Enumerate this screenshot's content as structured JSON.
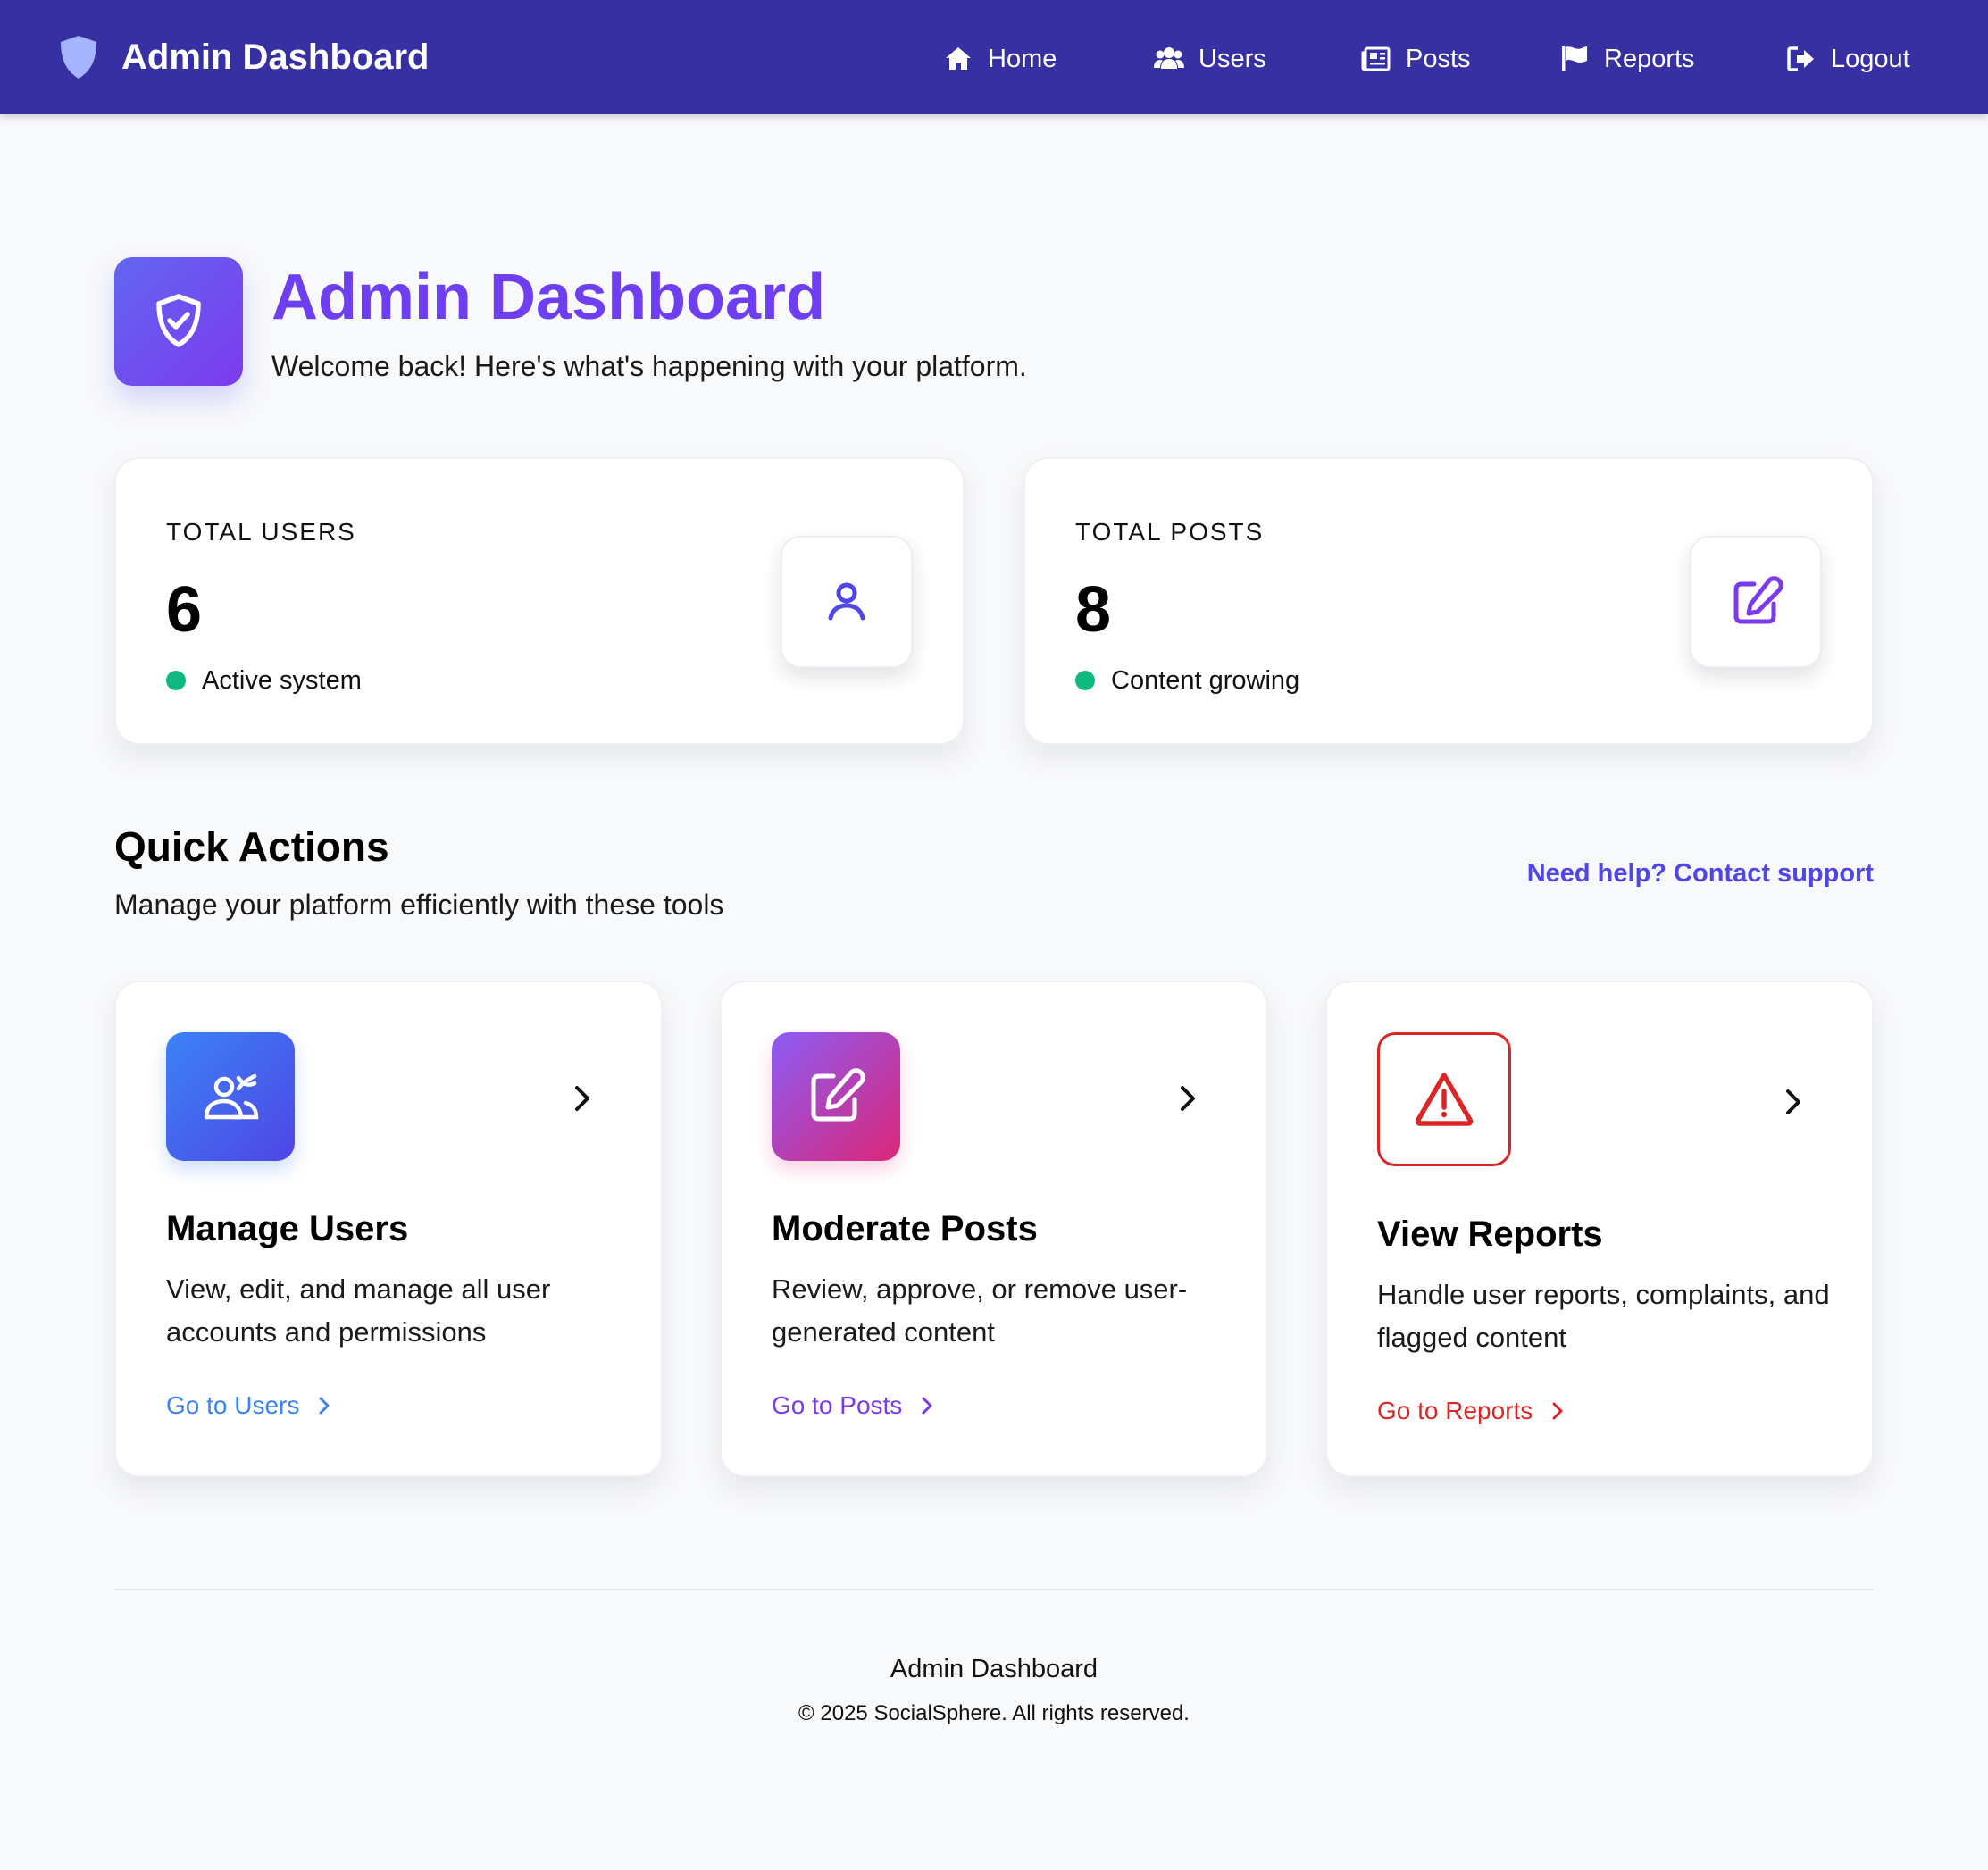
{
  "navbar": {
    "brand": "Admin Dashboard",
    "brand_icon": "shield-icon",
    "items": [
      {
        "label": "Home",
        "icon": "home-icon"
      },
      {
        "label": "Users",
        "icon": "users-icon"
      },
      {
        "label": "Posts",
        "icon": "newspaper-icon"
      },
      {
        "label": "Reports",
        "icon": "flag-icon"
      },
      {
        "label": "Logout",
        "icon": "logout-icon"
      }
    ],
    "background": "#3730a3"
  },
  "header": {
    "title": "Admin Dashboard",
    "subtitle": "Welcome back! Here's what's happening with your platform.",
    "icon": "shield-check-icon",
    "accent": "#6d3ff0"
  },
  "stats": [
    {
      "label": "TOTAL USERS",
      "value": "6",
      "status": "Active system",
      "icon": "user-icon",
      "icon_color": "#4f46e5",
      "status_color": "#10b981"
    },
    {
      "label": "TOTAL POSTS",
      "value": "8",
      "status": "Content growing",
      "icon": "edit-icon",
      "icon_color": "#7c3aed",
      "status_color": "#10b981"
    }
  ],
  "quick_actions": {
    "title": "Quick Actions",
    "subtitle": "Manage your platform efficiently with these tools",
    "help_link": "Need help? Contact support",
    "cards": [
      {
        "title": "Manage Users",
        "description": "View, edit, and manage all user accounts and permissions",
        "link": "Go to Users",
        "icon": "users-manage-icon",
        "color": "#3b82f6"
      },
      {
        "title": "Moderate Posts",
        "description": "Review, approve, or remove user-generated content",
        "link": "Go to Posts",
        "icon": "edit-icon",
        "color": "#7c3aed"
      },
      {
        "title": "View Reports",
        "description": "Handle user reports, complaints, and flagged content",
        "link": "Go to Reports",
        "icon": "warning-icon",
        "color": "#dc2626"
      }
    ]
  },
  "footer": {
    "title": "Admin Dashboard",
    "copyright": "© 2025 SocialSphere. All rights reserved."
  }
}
